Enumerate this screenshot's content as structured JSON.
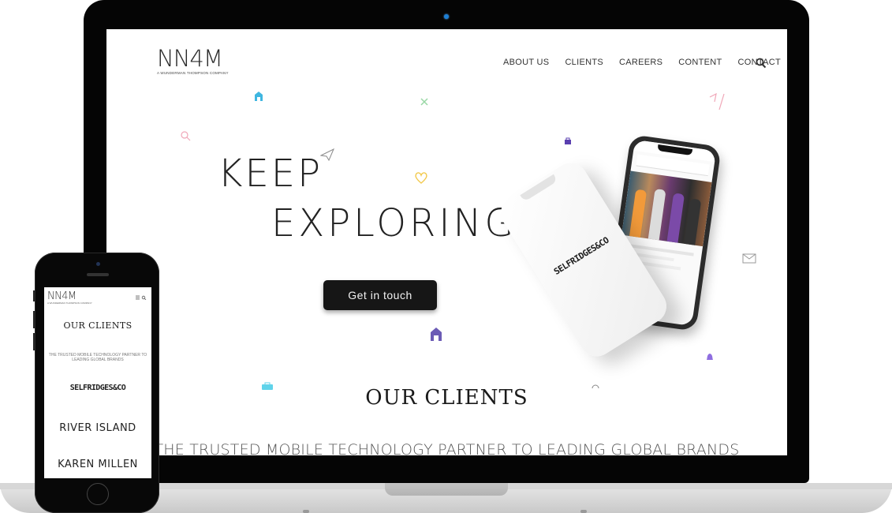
{
  "laptop": {
    "logo": {
      "text": "NN4M",
      "subtitle": "A WUNDERMAN THOMPSON COMPANY"
    },
    "nav": [
      "ABOUT US",
      "CLIENTS",
      "CAREERS",
      "CONTENT",
      "CONTACT"
    ],
    "hero": {
      "line1": "KEEP",
      "line2": "EXPLORING",
      "cta": "Get in touch"
    },
    "phone_brand": "SELFRIDGES&CO",
    "clients": {
      "title": "OUR CLIENTS",
      "subtitle": "THE TRUSTED MOBILE TECHNOLOGY PARTNER TO LEADING GLOBAL BRANDS"
    }
  },
  "phone": {
    "logo": {
      "text": "NN4M",
      "subtitle": "A WUNDERMAN THOMPSON COMPANY"
    },
    "title": "OUR CLIENTS",
    "subtitle": "THE TRUSTED MOBILE TECHNOLOGY PARTNER TO LEADING GLOBAL BRANDS",
    "brands": [
      "SELFRIDGES&CO",
      "RIVER ISLAND",
      "KAREN MILLEN"
    ]
  },
  "colors": {
    "accent_purple": "#6b5bb5",
    "accent_cyan": "#3fd0e8",
    "accent_yellow": "#f2c94c",
    "accent_pink": "#f0a7b8",
    "accent_green": "#7ed6a0"
  },
  "icons": [
    "search-icon",
    "home-icon",
    "heart-icon",
    "paper-plane-icon",
    "close-icon",
    "envelope-icon",
    "bell-icon",
    "bag-icon",
    "menu-icon"
  ]
}
